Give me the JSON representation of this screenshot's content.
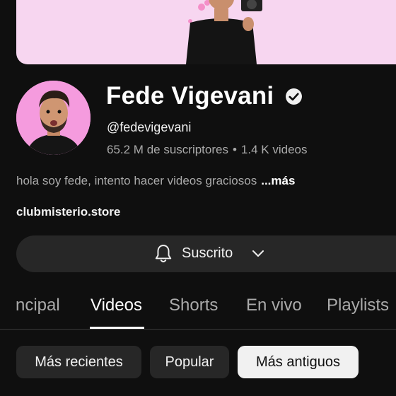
{
  "channel": {
    "name": "Fede Vigevani",
    "handle": "@fedevigevani",
    "subscribers": "65.2 M de suscriptores",
    "separator": "•",
    "videos": "1.4 K videos",
    "description": "hola soy fede, intento hacer videos graciosos",
    "more_label": "...más",
    "link": "clubmisterio.store"
  },
  "subscribe_button": {
    "label": "Suscrito",
    "icon": "bell-icon",
    "dropdown_icon": "chevron-down-icon"
  },
  "tabs": [
    {
      "label": "ncipal",
      "active": false
    },
    {
      "label": "Videos",
      "active": true
    },
    {
      "label": "Shorts",
      "active": false
    },
    {
      "label": "En vivo",
      "active": false
    },
    {
      "label": "Playlists",
      "active": false
    }
  ],
  "filters": [
    {
      "label": "Más recientes",
      "selected": false
    },
    {
      "label": "Popular",
      "selected": false
    },
    {
      "label": "Más antiguos",
      "selected": true
    }
  ],
  "colors": {
    "background": "#0f0f0f",
    "banner": "#f7d6f0",
    "avatar_bg": "#f59bde",
    "chip": "#272727",
    "chip_selected": "#f1f1f1"
  }
}
